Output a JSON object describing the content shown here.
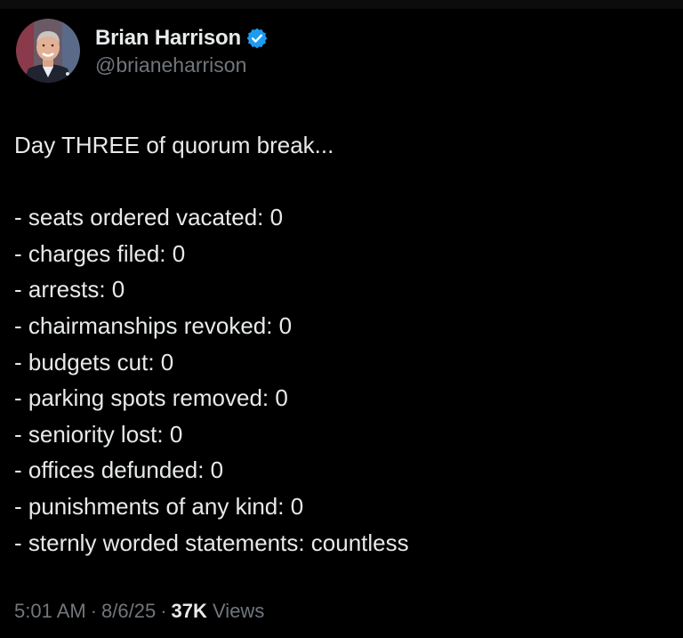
{
  "author": {
    "display_name": "Brian Harrison",
    "handle": "@brianeharrison",
    "verified": true,
    "verified_color": "#1d9bf0"
  },
  "tweet": {
    "intro": "Day THREE of quorum break...",
    "lines": [
      "- seats ordered vacated: 0",
      "- charges filed: 0",
      "- arrests: 0",
      "- chairmanships revoked: 0",
      "- budgets cut: 0",
      "- parking spots removed: 0",
      "- seniority lost: 0",
      "- offices defunded: 0",
      "- punishments of any kind: 0",
      "- sternly worded statements: countless"
    ]
  },
  "meta": {
    "time": "5:01 AM",
    "separator": "·",
    "date": "8/6/25",
    "views_count": "37K",
    "views_label": "Views"
  },
  "colors": {
    "background": "#000000",
    "text": "#e7e9ea",
    "secondary_text": "#71767b"
  }
}
